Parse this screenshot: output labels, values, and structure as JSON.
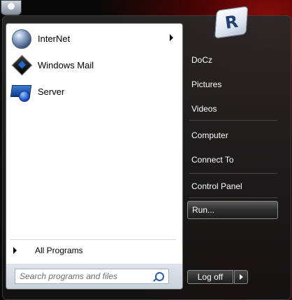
{
  "programs": [
    {
      "label": "InterNet",
      "icon": "globe-icon",
      "has_submenu": true
    },
    {
      "label": "Windows Mail",
      "icon": "windows-mail-icon",
      "has_submenu": false
    },
    {
      "label": "Server",
      "icon": "server-icon",
      "has_submenu": false
    }
  ],
  "all_programs": {
    "label": "All Programs"
  },
  "search": {
    "placeholder": "Search programs and files"
  },
  "right_links": [
    {
      "label": "DoCz"
    },
    {
      "label": "Pictures"
    },
    {
      "label": "Videos"
    },
    {
      "label": "Computer"
    },
    {
      "label": "Connect To"
    },
    {
      "label": "Control Panel"
    },
    {
      "label": "Run..."
    }
  ],
  "user": {
    "initial": "R"
  },
  "logoff": {
    "label": "Log off"
  },
  "colors": {
    "backdrop_red": "#8a0c0c",
    "left_pane": "#ffffff",
    "link_text": "#ffffff"
  }
}
